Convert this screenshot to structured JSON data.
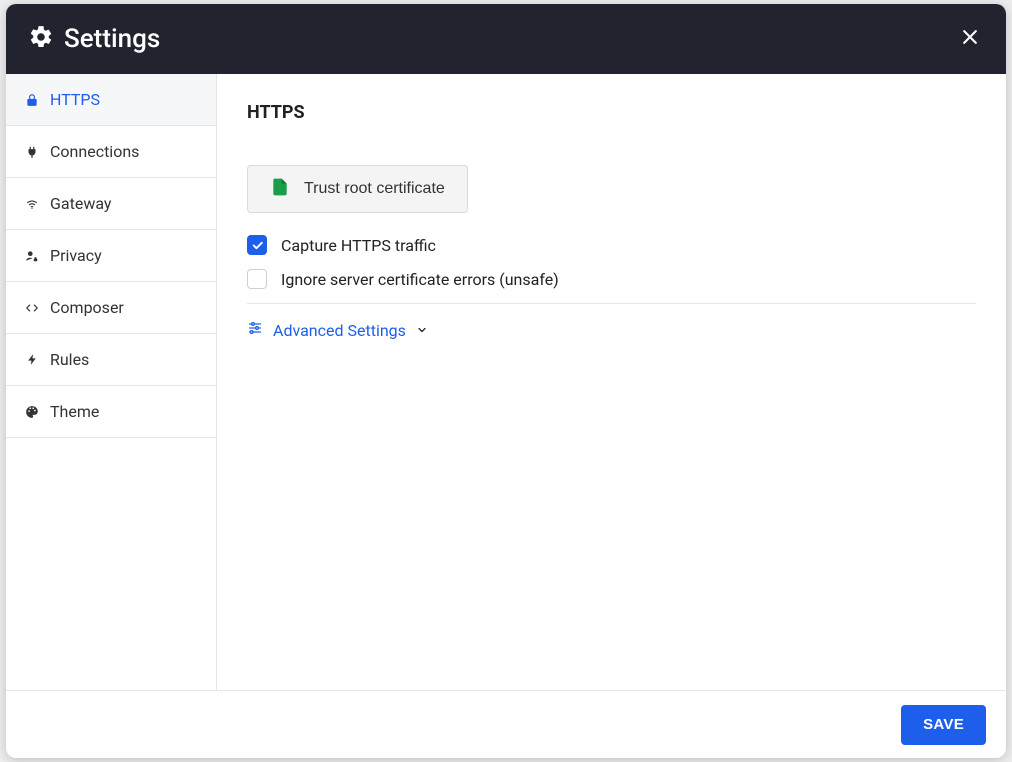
{
  "header": {
    "title": "Settings"
  },
  "sidebar": {
    "items": [
      {
        "label": "HTTPS",
        "icon": "lock-icon",
        "active": true
      },
      {
        "label": "Connections",
        "icon": "plug-icon",
        "active": false
      },
      {
        "label": "Gateway",
        "icon": "wifi-icon",
        "active": false
      },
      {
        "label": "Privacy",
        "icon": "user-lock-icon",
        "active": false
      },
      {
        "label": "Composer",
        "icon": "code-icon",
        "active": false
      },
      {
        "label": "Rules",
        "icon": "bolt-icon",
        "active": false
      },
      {
        "label": "Theme",
        "icon": "palette-icon",
        "active": false
      }
    ]
  },
  "main": {
    "title": "HTTPS",
    "trust_button_label": "Trust root certificate",
    "capture_label": "Capture HTTPS traffic",
    "capture_checked": true,
    "ignore_label": "Ignore server certificate errors (unsafe)",
    "ignore_checked": false,
    "advanced_label": "Advanced Settings"
  },
  "footer": {
    "save_label": "SAVE"
  }
}
